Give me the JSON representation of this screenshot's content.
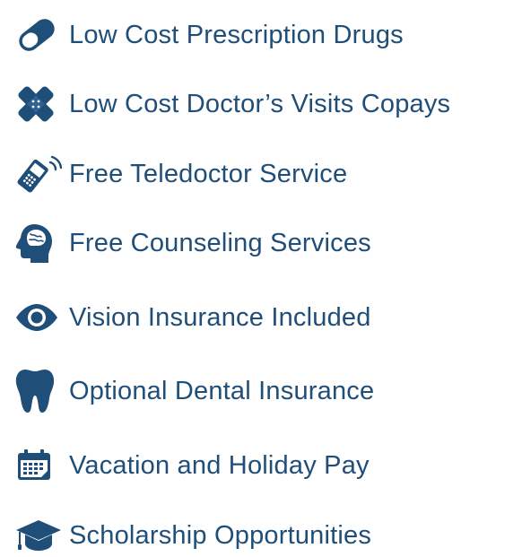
{
  "colors": {
    "text": "#1f4e79",
    "icon": "#1f4e79",
    "background": "#ffffff"
  },
  "benefits": [
    {
      "label": "Low Cost Prescription Drugs",
      "icon": "pill-icon"
    },
    {
      "label": "Low Cost Doctor’s Visits Copays",
      "icon": "bandage-icon"
    },
    {
      "label": "Free Teledoctor Service",
      "icon": "mobile-phone-icon"
    },
    {
      "label": "Free Counseling Services",
      "icon": "brain-head-icon"
    },
    {
      "label": "Vision Insurance Included",
      "icon": "eye-icon"
    },
    {
      "label": "Optional Dental Insurance",
      "icon": "tooth-icon"
    },
    {
      "label": "Vacation and Holiday Pay",
      "icon": "calendar-icon"
    },
    {
      "label": "Scholarship Opportunities",
      "icon": "graduation-cap-icon"
    }
  ]
}
